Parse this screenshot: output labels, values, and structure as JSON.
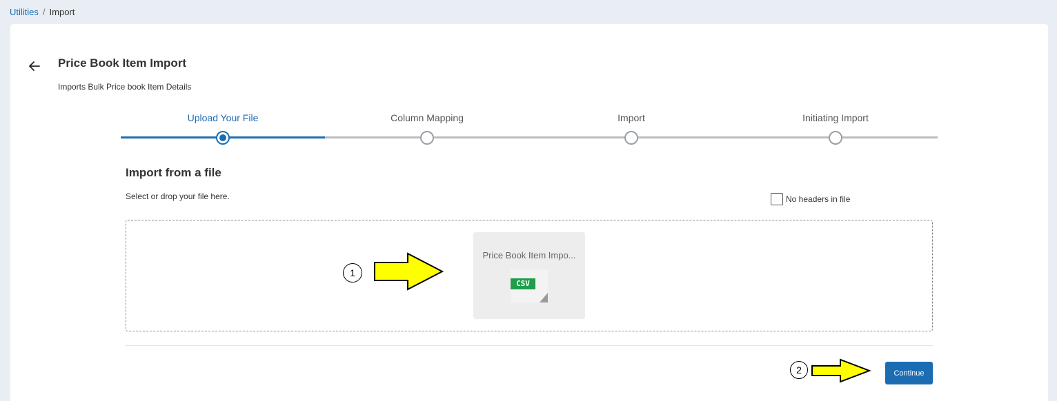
{
  "breadcrumb": {
    "parent": "Utilities",
    "separator": "/",
    "current": "Import"
  },
  "header": {
    "title": "Price Book Item Import",
    "subtitle": "Imports Bulk Price book Item Details"
  },
  "stepper": {
    "steps": [
      {
        "label": "Upload Your File",
        "state": "active"
      },
      {
        "label": "Column Mapping",
        "state": "pending"
      },
      {
        "label": "Import",
        "state": "pending"
      },
      {
        "label": "Initiating Import",
        "state": "pending"
      }
    ]
  },
  "upload": {
    "title": "Import from a file",
    "hint": "Select or drop your file here.",
    "no_headers_label": "No headers in file",
    "no_headers_checked": false,
    "file": {
      "name": "Price Book Item Impo...",
      "type_badge": "CSV"
    }
  },
  "actions": {
    "continue_label": "Continue"
  },
  "annotations": [
    {
      "number": "1"
    },
    {
      "number": "2"
    }
  ],
  "colors": {
    "accent": "#1a6cb3",
    "csv_badge": "#1e9e4a",
    "annotation_arrow": "#ffff00"
  }
}
